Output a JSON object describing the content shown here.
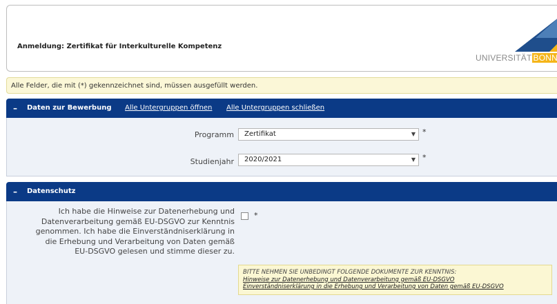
{
  "header": {
    "title": "Anmeldung: Zertifikat für Interkulturelle Kompetenz",
    "logo_text": "UNIVERSITÄT",
    "logo_text_highlight": "BONN"
  },
  "notice": "Alle Felder, die mit (*) gekennzeichnet sind, müssen ausgefüllt werden.",
  "section_application": {
    "toggle": "–",
    "title": "Daten zur Bewerbung",
    "open_all": "Alle Untergruppen öffnen",
    "close_all": "Alle Untergruppen schließen",
    "fields": [
      {
        "label": "Programm",
        "value": "Zertifikat",
        "required": "*"
      },
      {
        "label": "Studienjahr",
        "value": "2020/2021",
        "required": "*"
      }
    ]
  },
  "section_privacy": {
    "toggle": "–",
    "title": "Datenschutz",
    "consent_text": "Ich habe die Hinweise zur Datenerhebung und Datenverarbeitung gemäß EU-DSGVO zur Kenntnis genommen. Ich habe die Einverständniserklärung in die Erhebung und Verarbeitung von Daten gemäß EU-DSGVO gelesen und stimme dieser zu.",
    "required": "*",
    "consent_checked": false,
    "documents_heading": "BITTE NEHMEN SIE UNBEDINGT FOLGENDE DOKUMENTE ZUR KENNTNIS:",
    "documents": [
      "Hinweise zur Datenerhebung und Datenverarbeitung gemäß EU-DSGVO",
      "Einverständniserklärung in die Erhebung und Verarbeitung von Daten gemäß EU-DSGVO"
    ]
  },
  "colors": {
    "section_bar": "#0b3a86",
    "notice_bg": "#fbf7d7",
    "logo_accent": "#f5b519",
    "logo_blue": "#1f4e8c"
  },
  "icons": {
    "select_arrow": "chevron-down-icon"
  }
}
